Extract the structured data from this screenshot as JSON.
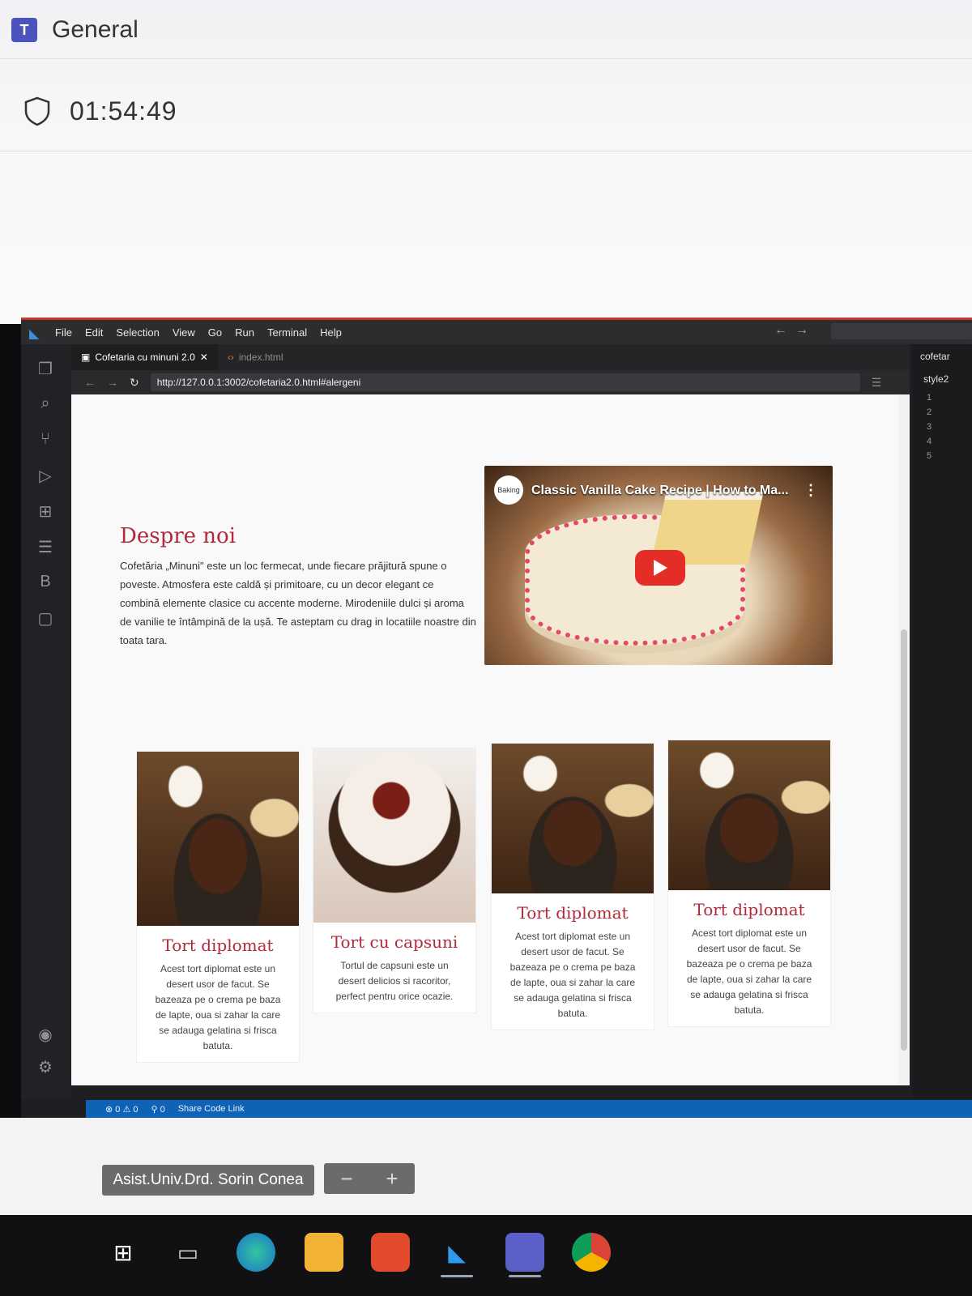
{
  "teams": {
    "logo_text": "T",
    "channel_title": "General",
    "call_timer": "01:54:49"
  },
  "vscode": {
    "menu": [
      "File",
      "Edit",
      "Selection",
      "View",
      "Go",
      "Run",
      "Terminal",
      "Help"
    ],
    "tabs": [
      {
        "label": "Cofetaria cu minuni 2.0",
        "active": true
      },
      {
        "label": "index.html",
        "active": false
      }
    ],
    "address_url": "http://127.0.0.1:3002/cofetaria2.0.html#alergeni",
    "right_panel": {
      "tab1": "cofetar",
      "tab2": "style2",
      "line_numbers": [
        "1",
        "2",
        "3",
        "4",
        "5"
      ]
    },
    "status_bar": {
      "problems": "⊗ 0 ⚠ 0",
      "ports": "⚲ 0",
      "share": "Share Code Link"
    }
  },
  "page": {
    "about_title": "Despre noi",
    "about_text": "Cofetăria „Minuni\" este un loc fermecat, unde fiecare prăjitură spune o poveste. Atmosfera este caldă și primitoare, cu un decor elegant ce combină elemente clasice cu accente moderne. Mirodeniile dulci și aroma de vanilie te întâmpină de la ușă. Te asteptam cu drag in locatiile noastre din toata tara.",
    "video": {
      "title": "Classic Vanilla Cake Recipe | How to Ma...",
      "channel_badge": "Baking"
    },
    "cards": [
      {
        "title": "Tort diplomat",
        "text": "Acest tort diplomat este un desert usor de facut. Se bazeaza pe o crema pe baza de lapte, oua si zahar la care se adauga gelatina si frisca batuta."
      },
      {
        "title": "Tort cu capsuni",
        "text": "Tortul de capsuni este un desert delicios si racoritor, perfect pentru orice ocazie."
      },
      {
        "title": "Tort diplomat",
        "text": "Acest tort diplomat este un desert usor de facut. Se bazeaza pe o crema pe baza de lapte, oua si zahar la care se adauga gelatina si frisca batuta."
      },
      {
        "title": "Tort diplomat",
        "text": "Acest tort diplomat este un desert usor de facut. Se bazeaza pe o crema pe baza de lapte, oua si zahar la care se adauga gelatina si frisca batuta."
      }
    ]
  },
  "presenter": {
    "name": "Asist.Univ.Drd. Sorin Conea",
    "zoom_out": "−",
    "zoom_in": "+"
  },
  "taskbar": {
    "icons": [
      "windows-start-icon",
      "task-view-icon",
      "edge-icon",
      "file-explorer-icon",
      "brave-icon",
      "vscode-icon",
      "teams-icon",
      "chrome-icon"
    ]
  },
  "colors": {
    "accent_red": "#b02a3a",
    "status_blue": "#0e63b7",
    "teams_purple": "#4b53bc"
  }
}
